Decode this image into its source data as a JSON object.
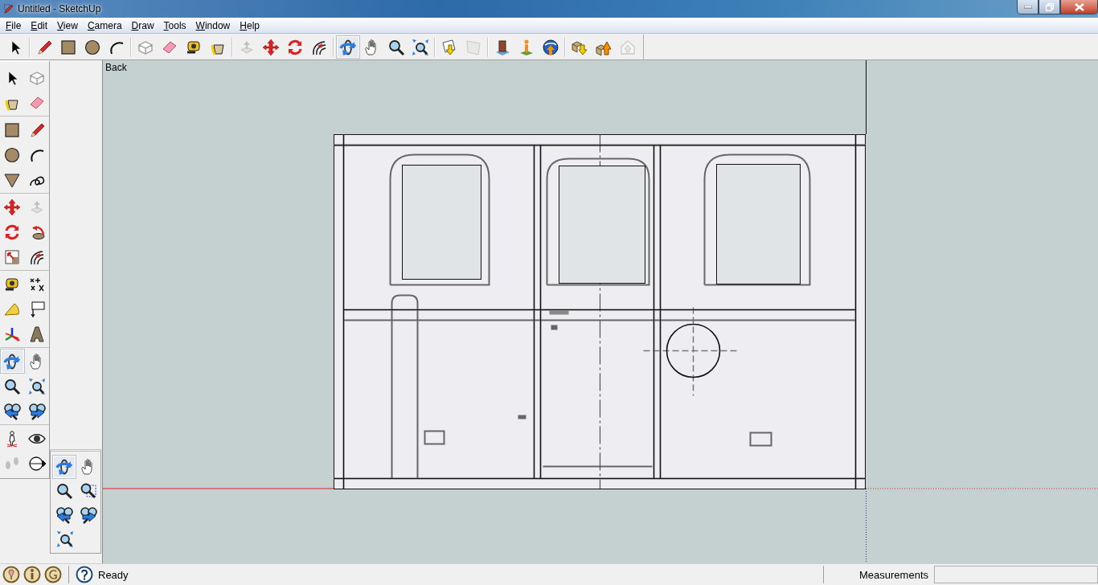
{
  "window": {
    "title": "Untitled - SketchUp"
  },
  "menu": [
    {
      "label": "File"
    },
    {
      "label": "Edit"
    },
    {
      "label": "View"
    },
    {
      "label": "Camera"
    },
    {
      "label": "Draw"
    },
    {
      "label": "Tools"
    },
    {
      "label": "Window"
    },
    {
      "label": "Help"
    }
  ],
  "toolbar": [
    {
      "kind": "select",
      "selected": false,
      "disabled": false
    },
    {
      "kind": "sep"
    },
    {
      "kind": "pencil",
      "selected": false,
      "disabled": false
    },
    {
      "kind": "rectangle",
      "selected": false,
      "disabled": false
    },
    {
      "kind": "circle",
      "selected": false,
      "disabled": false
    },
    {
      "kind": "arc",
      "selected": false,
      "disabled": false
    },
    {
      "kind": "sep"
    },
    {
      "kind": "component",
      "selected": false,
      "disabled": false
    },
    {
      "kind": "eraser",
      "selected": false,
      "disabled": false
    },
    {
      "kind": "tape",
      "selected": false,
      "disabled": false
    },
    {
      "kind": "paint",
      "selected": false,
      "disabled": false
    },
    {
      "kind": "sep"
    },
    {
      "kind": "pushpull",
      "selected": false,
      "disabled": true
    },
    {
      "kind": "move",
      "selected": false,
      "disabled": false
    },
    {
      "kind": "rotate",
      "selected": false,
      "disabled": false
    },
    {
      "kind": "offset",
      "selected": false,
      "disabled": false
    },
    {
      "kind": "sep"
    },
    {
      "kind": "orbit",
      "selected": true,
      "disabled": false
    },
    {
      "kind": "pan",
      "selected": false,
      "disabled": false
    },
    {
      "kind": "zoom",
      "selected": false,
      "disabled": false
    },
    {
      "kind": "zoomext",
      "selected": false,
      "disabled": false
    },
    {
      "kind": "sep"
    },
    {
      "kind": "importdoc",
      "selected": false,
      "disabled": false
    },
    {
      "kind": "phototexture",
      "selected": false,
      "disabled": true
    },
    {
      "kind": "sep"
    },
    {
      "kind": "getmodels",
      "selected": false,
      "disabled": false
    },
    {
      "kind": "placemodel",
      "selected": false,
      "disabled": false
    },
    {
      "kind": "globe",
      "selected": false,
      "disabled": false
    },
    {
      "kind": "sep"
    },
    {
      "kind": "getcomponents",
      "selected": false,
      "disabled": false
    },
    {
      "kind": "share",
      "selected": false,
      "disabled": false
    },
    {
      "kind": "uploadcomp",
      "selected": false,
      "disabled": true
    }
  ],
  "palette": [
    [
      [
        {
          "kind": "select",
          "selected": false,
          "disabled": false
        },
        {
          "kind": "component",
          "selected": false,
          "disabled": false
        }
      ],
      [
        {
          "kind": "paint",
          "selected": false,
          "disabled": false
        },
        {
          "kind": "eraser",
          "selected": false,
          "disabled": false
        }
      ]
    ],
    [
      [
        {
          "kind": "rectangle",
          "selected": false,
          "disabled": false
        },
        {
          "kind": "pencil",
          "selected": false,
          "disabled": false
        }
      ],
      [
        {
          "kind": "circle",
          "selected": false,
          "disabled": false
        },
        {
          "kind": "arc",
          "selected": false,
          "disabled": false
        }
      ],
      [
        {
          "kind": "polygon",
          "selected": false,
          "disabled": false
        },
        {
          "kind": "freehand",
          "selected": false,
          "disabled": false
        }
      ]
    ],
    [
      [
        {
          "kind": "move",
          "selected": false,
          "disabled": false
        },
        {
          "kind": "pushpull",
          "selected": false,
          "disabled": true
        }
      ],
      [
        {
          "kind": "rotate",
          "selected": false,
          "disabled": false
        },
        {
          "kind": "followme",
          "selected": false,
          "disabled": false
        }
      ],
      [
        {
          "kind": "scale",
          "selected": false,
          "disabled": false
        },
        {
          "kind": "offset",
          "selected": false,
          "disabled": false
        }
      ]
    ],
    [
      [
        {
          "kind": "tape",
          "selected": false,
          "disabled": false
        },
        {
          "kind": "dimension",
          "selected": false,
          "disabled": false
        }
      ],
      [
        {
          "kind": "protractor",
          "selected": false,
          "disabled": false
        },
        {
          "kind": "text",
          "selected": false,
          "disabled": false
        }
      ],
      [
        {
          "kind": "axes",
          "selected": false,
          "disabled": false
        },
        {
          "kind": "text3d",
          "selected": false,
          "disabled": false
        }
      ]
    ],
    [
      [
        {
          "kind": "orbit",
          "selected": true,
          "disabled": false
        },
        {
          "kind": "pan",
          "selected": false,
          "disabled": false
        }
      ],
      [
        {
          "kind": "zoom",
          "selected": false,
          "disabled": false
        },
        {
          "kind": "zoomext",
          "selected": false,
          "disabled": false
        }
      ],
      [
        {
          "kind": "previous",
          "selected": false,
          "disabled": false
        },
        {
          "kind": "next",
          "selected": false,
          "disabled": false
        }
      ]
    ],
    [
      [
        {
          "kind": "walk",
          "selected": false,
          "disabled": false
        },
        {
          "kind": "lookaround",
          "selected": false,
          "disabled": false
        }
      ],
      [
        {
          "kind": "footprints",
          "selected": false,
          "disabled": true
        },
        {
          "kind": "section",
          "selected": false,
          "disabled": false
        }
      ]
    ]
  ],
  "camera_toolbar": [
    [
      {
        "kind": "orbit",
        "selected": true,
        "disabled": false
      },
      {
        "kind": "pan",
        "selected": false,
        "disabled": false
      }
    ],
    [
      {
        "kind": "zoom",
        "selected": false,
        "disabled": false
      },
      {
        "kind": "zoomwindow",
        "selected": false,
        "disabled": false
      }
    ],
    [
      {
        "kind": "previous",
        "selected": false,
        "disabled": false
      },
      {
        "kind": "next",
        "selected": false,
        "disabled": false
      }
    ],
    [
      {
        "kind": "zoomext",
        "selected": false,
        "disabled": false
      }
    ]
  ],
  "viewport": {
    "view_label": "Back"
  },
  "status_bar": {
    "text": "Ready",
    "measurements_label": "Measurements"
  }
}
